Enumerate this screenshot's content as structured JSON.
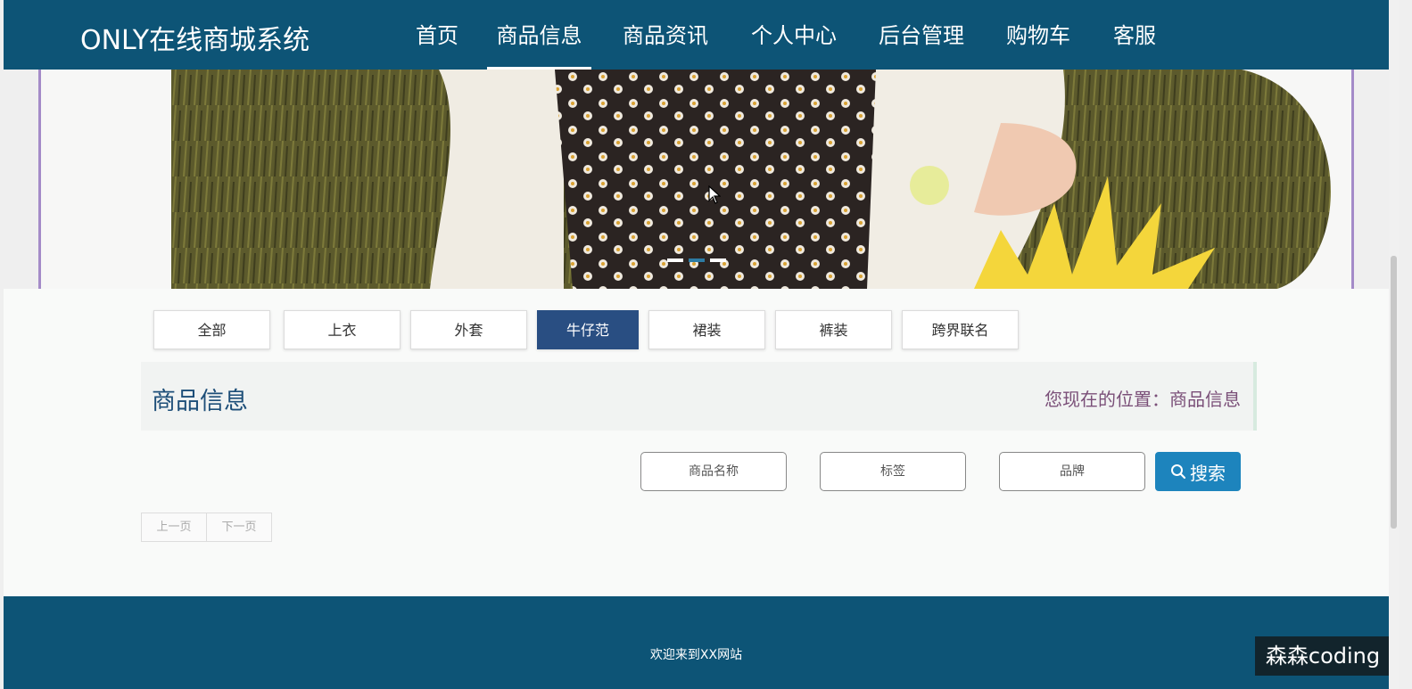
{
  "header": {
    "brand": "ONLY在线商城系统",
    "nav": [
      {
        "label": "首页"
      },
      {
        "label": "商品信息",
        "active": true
      },
      {
        "label": "商品资讯"
      },
      {
        "label": "个人中心"
      },
      {
        "label": "后台管理"
      },
      {
        "label": "购物车"
      },
      {
        "label": "客服"
      }
    ]
  },
  "banner": {
    "slides": 3,
    "active_slide": 2
  },
  "categories": [
    {
      "label": "全部"
    },
    {
      "label": "上衣"
    },
    {
      "label": "外套"
    },
    {
      "label": "牛仔范",
      "active": true
    },
    {
      "label": "裙装"
    },
    {
      "label": "裤装"
    },
    {
      "label": "跨界联名"
    }
  ],
  "section": {
    "title": "商品信息",
    "breadcrumb": "您现在的位置：商品信息"
  },
  "search": {
    "name_placeholder": "商品名称",
    "tag_placeholder": "标签",
    "brand_placeholder": "品牌",
    "button_label": "搜索",
    "button_icon": "search-icon"
  },
  "pagination": {
    "prev": "上一页",
    "next": "下一页"
  },
  "footer": {
    "text": "欢迎来到XX网站"
  },
  "watermark": {
    "text": "森森coding"
  },
  "colors": {
    "nav_bg": "#0d5476",
    "active_category": "#294e82",
    "search_button": "#1d84bd",
    "section_title": "#1d4e78",
    "breadcrumb": "#7a4f78"
  }
}
